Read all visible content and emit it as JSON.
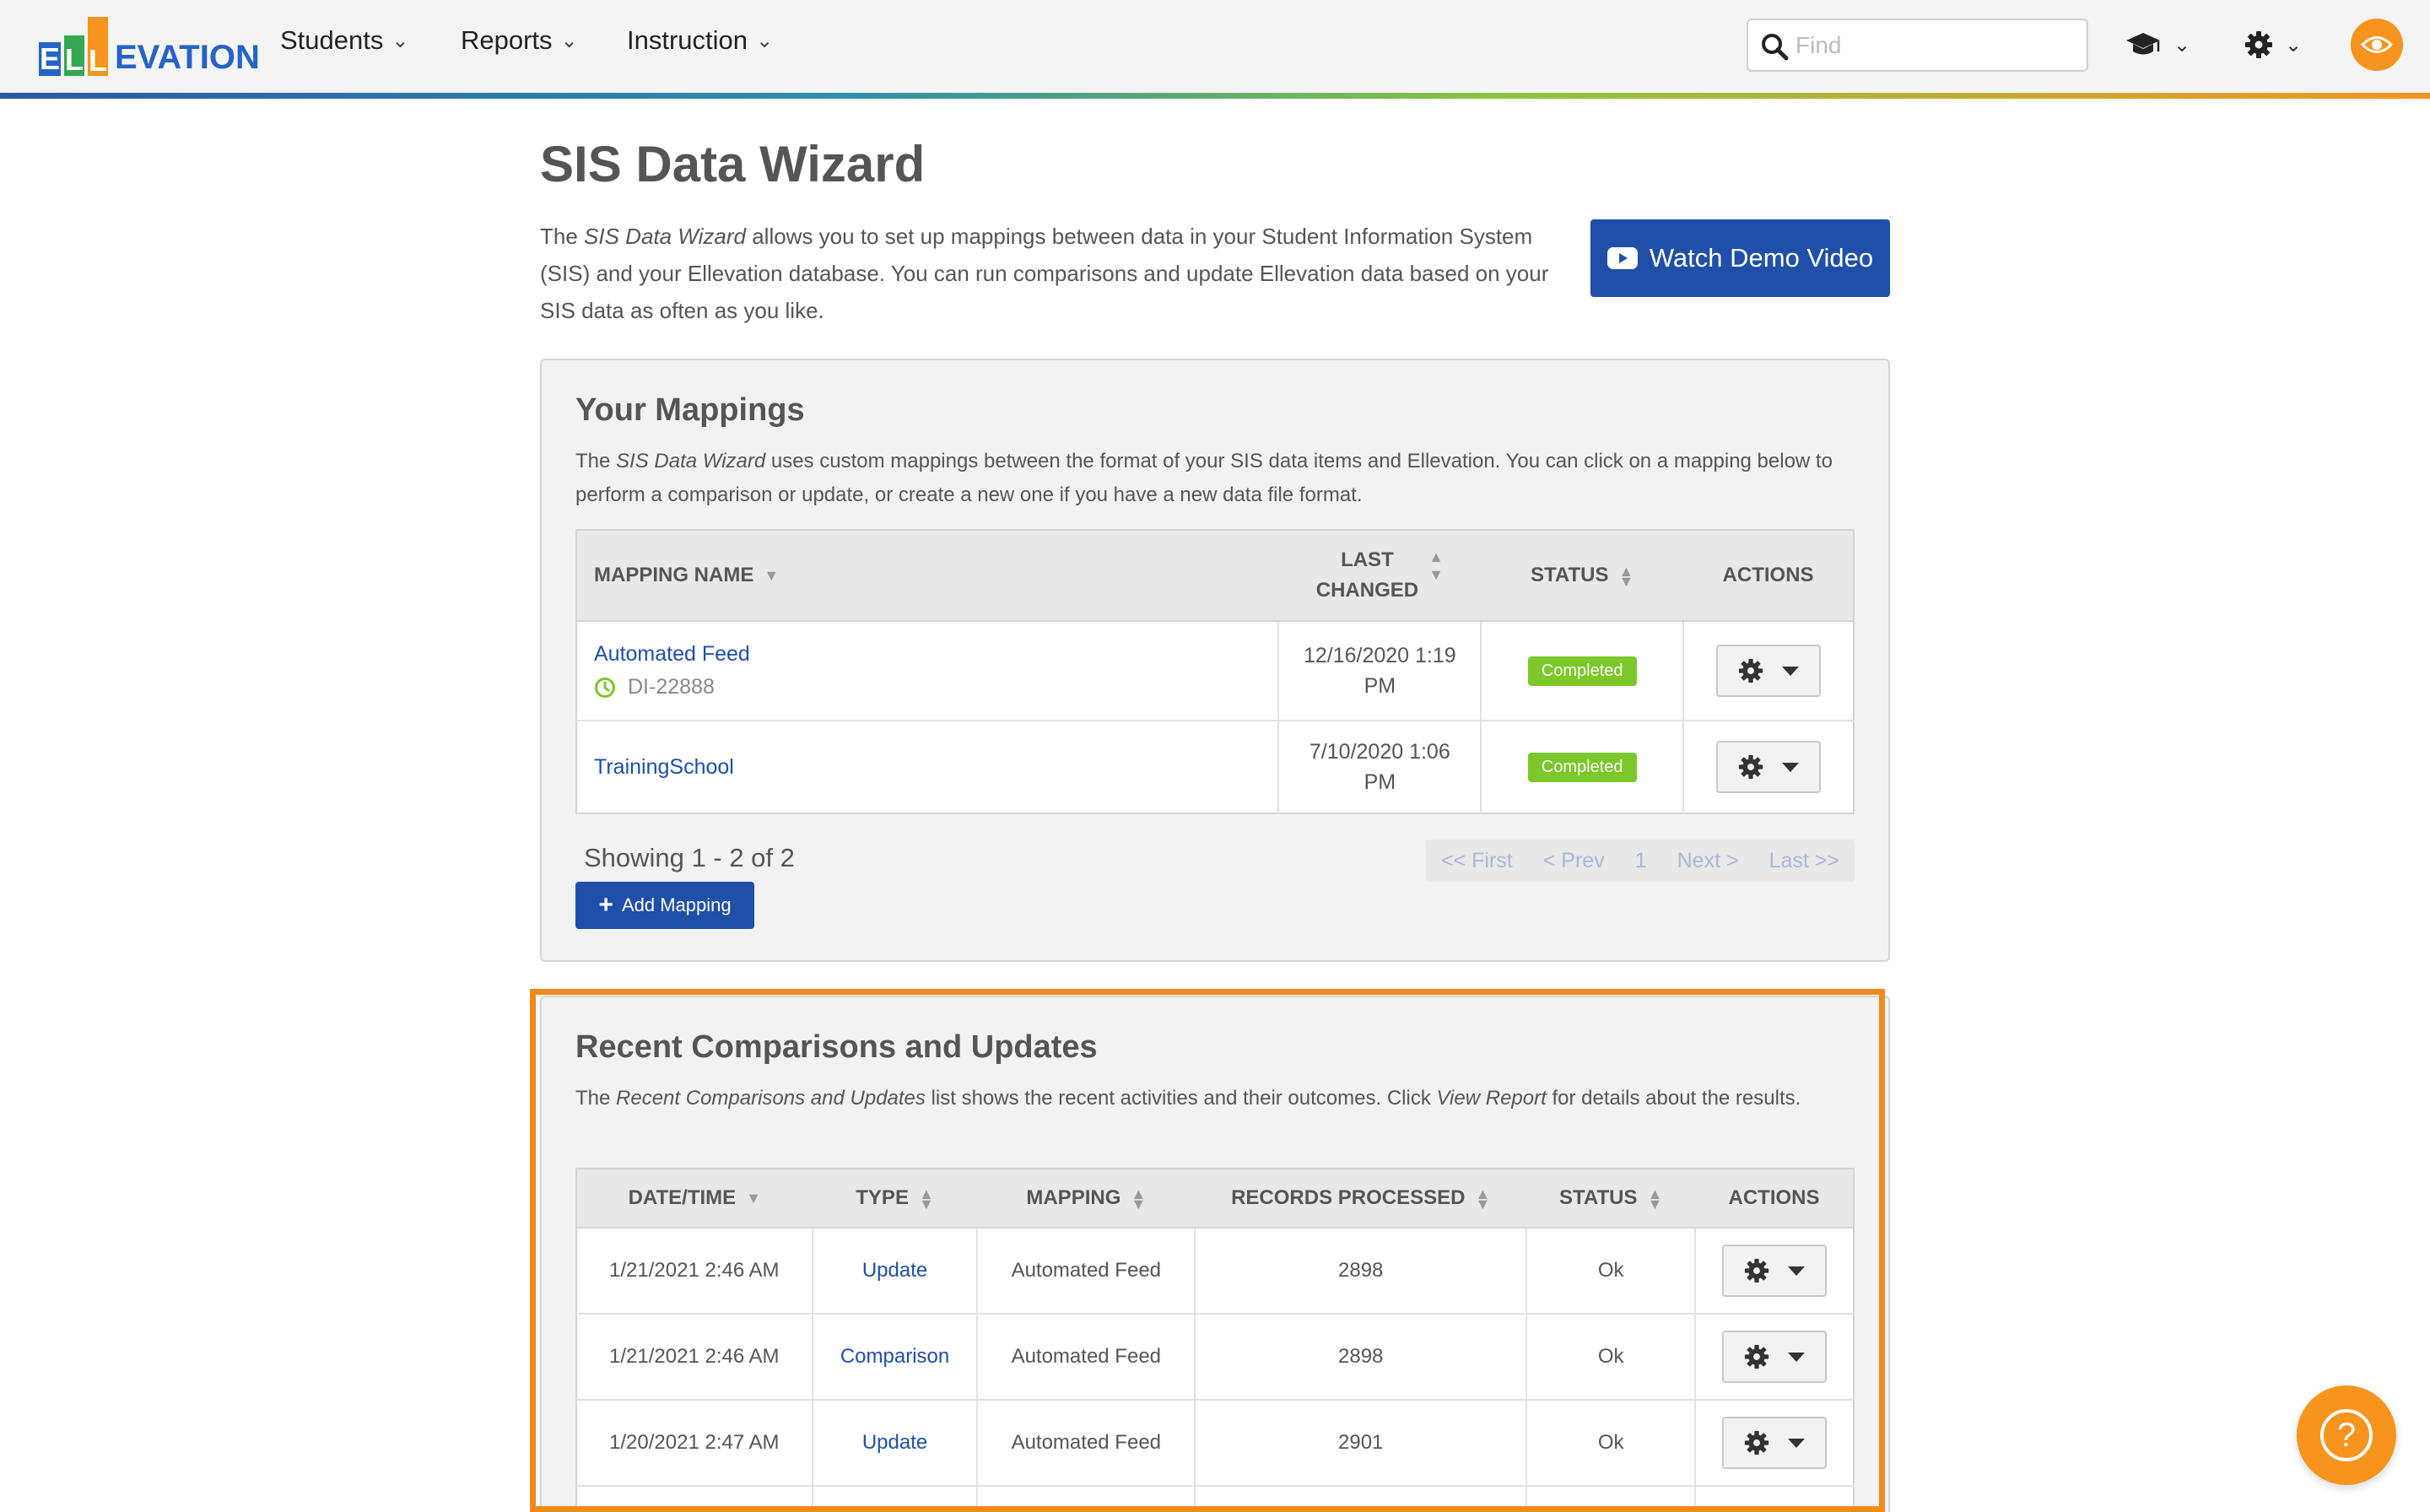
{
  "nav": {
    "logo_e": "E",
    "logo_l1": "L",
    "logo_l2": "L",
    "logo_rest": "EVATION",
    "items": [
      {
        "label": "Students"
      },
      {
        "label": "Reports"
      },
      {
        "label": "Instruction"
      }
    ],
    "find_placeholder": "Find",
    "icons": [
      "graduation-cap-icon",
      "gear-icon",
      "eye-icon"
    ]
  },
  "page": {
    "title": "SIS Data Wizard",
    "intro_pre": "The ",
    "intro_em": "SIS Data Wizard",
    "intro_post": " allows you to set up mappings between data in your Student Information System (SIS) and your Ellevation database. You can run comparisons and update Ellevation data based on your SIS data as often as you like.",
    "demo_button": "Watch Demo Video"
  },
  "mappings": {
    "title": "Your Mappings",
    "desc_pre": "The ",
    "desc_em": "SIS Data Wizard",
    "desc_post": " uses custom mappings between the format of your SIS data items and Ellevation. You can click on a mapping below to perform a comparison or update, or create a new one if you have a new data file format.",
    "columns": {
      "name": "Mapping Name",
      "changed_l1": "Last",
      "changed_l2": "Changed",
      "status": "Status",
      "actions": "Actions"
    },
    "rows": [
      {
        "name": "Automated Feed",
        "sub": "DI-22888",
        "changed": "12/16/2020 1:19 PM",
        "status": "Completed"
      },
      {
        "name": "TrainingSchool",
        "sub": "",
        "changed": "7/10/2020 1:06 PM",
        "status": "Completed"
      }
    ],
    "showing": "Showing 1 - 2 of 2",
    "pager": {
      "first": "<< First",
      "prev": "< Prev",
      "page": "1",
      "next": "Next >",
      "last": "Last >>"
    },
    "add_button": "Add Mapping"
  },
  "recent": {
    "title": "Recent Comparisons and Updates",
    "desc_pre": "The ",
    "desc_em1": "Recent Comparisons and Updates",
    "desc_mid": " list shows the recent activities and their outcomes. Click ",
    "desc_em2": "View Report",
    "desc_post": " for details about the results.",
    "columns": {
      "datetime": "Date/Time",
      "type": "Type",
      "mapping": "Mapping",
      "records": "Records Processed",
      "status": "Status",
      "actions": "Actions"
    },
    "rows": [
      {
        "datetime": "1/21/2021 2:46 AM",
        "type": "Update",
        "mapping": "Automated Feed",
        "records": "2898",
        "status": "Ok"
      },
      {
        "datetime": "1/21/2021 2:46 AM",
        "type": "Comparison",
        "mapping": "Automated Feed",
        "records": "2898",
        "status": "Ok"
      },
      {
        "datetime": "1/20/2021 2:47 AM",
        "type": "Update",
        "mapping": "Automated Feed",
        "records": "2901",
        "status": "Ok"
      }
    ]
  },
  "colors": {
    "brand_blue": "#1f4fa8",
    "accent_orange": "#f7941d",
    "status_green": "#7cc72a"
  }
}
